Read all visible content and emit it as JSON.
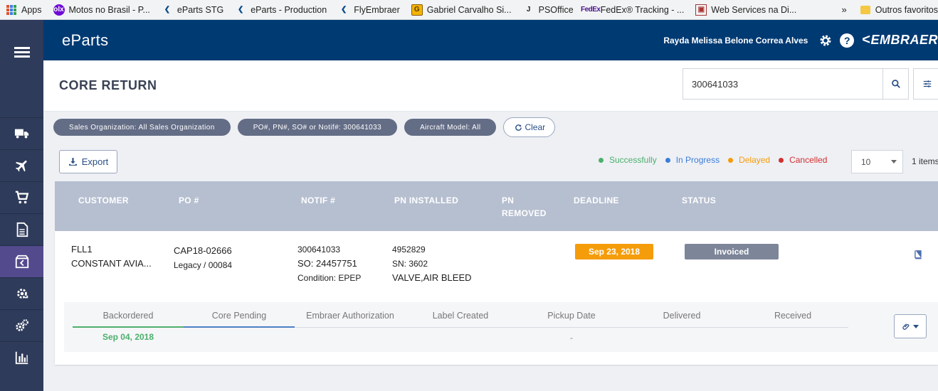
{
  "bookmarks": [
    {
      "label": "Apps",
      "icon": "apps-grid-icon"
    },
    {
      "label": "Motos no Brasil - P...",
      "icon": "olx-icon"
    },
    {
      "label": "eParts STG",
      "icon": "embraer-icon"
    },
    {
      "label": "eParts - Production",
      "icon": "embraer-icon"
    },
    {
      "label": "FlyEmbraer",
      "icon": "embraer-icon"
    },
    {
      "label": "Gabriel Carvalho Si...",
      "icon": "gc-icon"
    },
    {
      "label": "PSOffice",
      "icon": "psoffice-icon"
    },
    {
      "label": "FedEx® Tracking - ...",
      "icon": "fedex-icon"
    },
    {
      "label": "Web Services na Di...",
      "icon": "webservice-icon"
    }
  ],
  "bookmarks_more": "»",
  "bookmarks_other": "Outros favoritos",
  "icon_text": {
    "olx": "olx",
    "gc": "G",
    "ps": "J",
    "fedex": "FedEx",
    "ws": "▣",
    "help": "?",
    "logo_arrow": "<"
  },
  "header": {
    "brand": "eParts",
    "user_name": "Rayda Melissa Belone Correa Alves",
    "logo_text": "EMBRAER"
  },
  "page": {
    "title": "CORE RETURN"
  },
  "search": {
    "value": "300641033"
  },
  "filters": {
    "chips": [
      "Sales Organization: All Sales Organization",
      "PO#, PN#, SO# or Notif#: 300641033",
      "Aircraft Model: All"
    ],
    "clear_label": "Clear"
  },
  "toolbar": {
    "export_label": "Export",
    "page_size": "10",
    "items_count": "1 items"
  },
  "legend": [
    {
      "label": "Successfully",
      "color": "#4caf6c"
    },
    {
      "label": "In Progress",
      "color": "#3b7dd8"
    },
    {
      "label": "Delayed",
      "color": "#f59c0b"
    },
    {
      "label": "Cancelled",
      "color": "#d32f2f"
    }
  ],
  "table": {
    "columns": [
      "CUSTOMER",
      "PO #",
      "NOTIF #",
      "PN INSTALLED",
      "PN REMOVED",
      "DEADLINE",
      "STATUS"
    ],
    "rows": [
      {
        "customer_code": "FLL1",
        "customer_name": "CONSTANT AVIA...",
        "po": "CAP18-02666",
        "po_sub": "Legacy / 00084",
        "notif": "300641033",
        "so": "SO: 24457751",
        "condition": "Condition: EPEP",
        "pn_installed": "4952829",
        "sn": "SN: 3602",
        "description": "VALVE,AIR BLEED",
        "deadline": "Sep 23, 2018",
        "status": "Invoiced"
      }
    ]
  },
  "tracker": {
    "steps": [
      "Backordered",
      "Core Pending",
      "Embraer Authorization",
      "Label Created",
      "Pickup Date",
      "Delivered",
      "Received"
    ],
    "backordered_date": "Sep 04, 2018",
    "pickup_date": "-"
  },
  "colors": {
    "header_bg": "#003a73",
    "sidebar_bg": "#2f3b5a",
    "sidebar_active": "#534a8e",
    "deadline_bg": "#f59c0b",
    "status_bg": "#7d8599"
  }
}
